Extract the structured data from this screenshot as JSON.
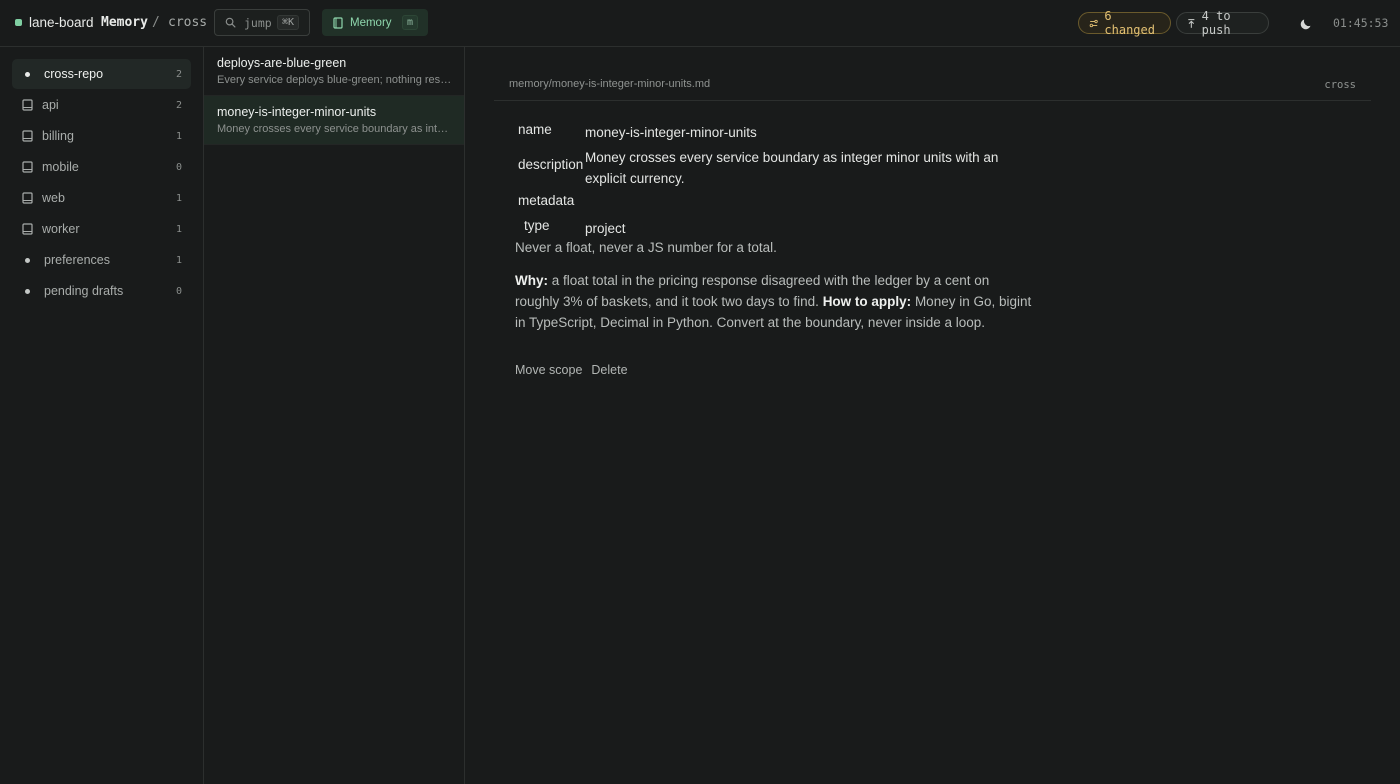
{
  "header": {
    "app_name": "lane-board",
    "crumb_section": "Memory",
    "crumb_separator": "/",
    "crumb_scope": "cross",
    "jump_label": "jump",
    "jump_shortcut": "⌘K",
    "mode_label": "Memory",
    "mode_shortcut": "m",
    "changed_label": "6 changed",
    "push_label": "4 to push",
    "clock": "01:45:53"
  },
  "sidebar": {
    "items": [
      {
        "label": "cross-repo",
        "count": "2",
        "icon": "dot-icon",
        "active": true
      },
      {
        "label": "api",
        "count": "2",
        "icon": "book-icon"
      },
      {
        "label": "billing",
        "count": "1",
        "icon": "book-icon"
      },
      {
        "label": "mobile",
        "count": "0",
        "icon": "book-icon"
      },
      {
        "label": "web",
        "count": "1",
        "icon": "book-icon"
      },
      {
        "label": "worker",
        "count": "1",
        "icon": "book-icon"
      },
      {
        "label": "preferences",
        "count": "1",
        "icon": "dot-icon"
      },
      {
        "label": "pending drafts",
        "count": "0",
        "icon": "dot-icon"
      }
    ]
  },
  "list": {
    "items": [
      {
        "title": "deploys-are-blue-green",
        "desc": "Every service deploys blue-green; nothing restarts in place."
      },
      {
        "title": "money-is-integer-minor-units",
        "desc": "Money crosses every service boundary as integer minor units.",
        "active": true
      }
    ]
  },
  "detail": {
    "path": "memory/money-is-integer-minor-units.md",
    "scope": "cross",
    "frontmatter": {
      "name_key": "name",
      "name_val": "money-is-integer-minor-units",
      "description_key": "description",
      "description_val": "Money crosses every service boundary as integer minor units with an explicit currency.",
      "metadata_key": "metadata",
      "type_key": "type",
      "type_val": "project"
    },
    "body": {
      "line1": "Never a float, never a JS number for a total.",
      "why_label": "Why:",
      "why_text": " a float total in the pricing response disagreed with the ledger by a cent on roughly 3% of baskets, and it took two days to find. ",
      "how_label": "How to apply:",
      "how_text": " Money in Go, bigint in TypeScript, Decimal in Python. Convert at the boundary, never inside a loop."
    },
    "actions": {
      "move_label": "Move scope",
      "delete_label": "Delete"
    }
  }
}
